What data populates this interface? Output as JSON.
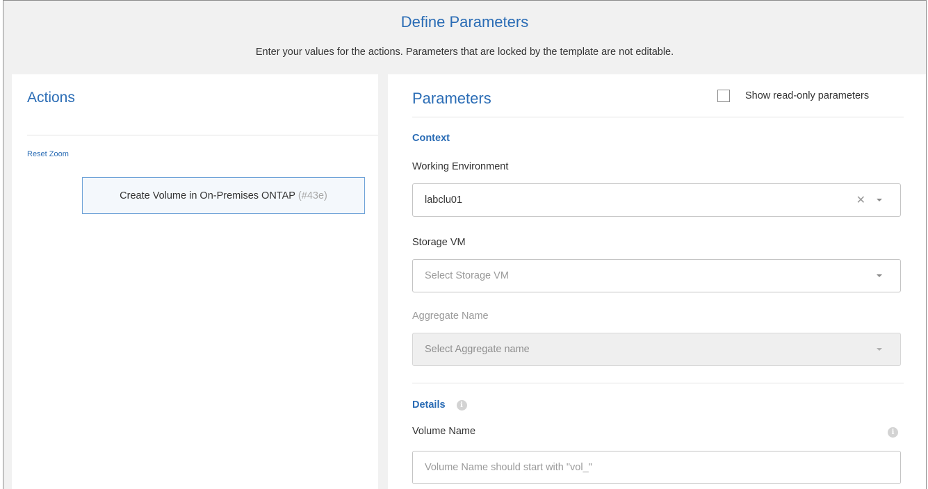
{
  "header": {
    "title": "Define Parameters",
    "subtitle": "Enter your values for the actions. Parameters that are locked by the template are not editable."
  },
  "actions": {
    "title": "Actions",
    "reset_zoom": "Reset Zoom",
    "node": {
      "label": "Create Volume in On-Premises ONTAP",
      "id": "(#43e)"
    }
  },
  "parameters": {
    "title": "Parameters",
    "show_readonly_label": "Show read-only parameters",
    "show_readonly_checked": false,
    "context": {
      "section_title": "Context",
      "working_environment": {
        "label": "Working Environment",
        "value": "labclu01",
        "clear_icon": "close-icon",
        "dropdown_icon": "chevron-down-icon"
      },
      "storage_vm": {
        "label": "Storage VM",
        "placeholder": "Select Storage VM"
      },
      "aggregate_name": {
        "label": "Aggregate Name",
        "placeholder": "Select Aggregate name",
        "disabled": true
      }
    },
    "details": {
      "section_title": "Details",
      "info_icon": "info-icon",
      "volume_name": {
        "label": "Volume Name",
        "placeholder": "Volume Name should start with \"vol_\""
      }
    }
  },
  "colors": {
    "accent": "#2a6cb5",
    "header_bg": "#f1f1f1",
    "panel_bg": "#ffffff",
    "node_border": "#6fa3d8"
  }
}
